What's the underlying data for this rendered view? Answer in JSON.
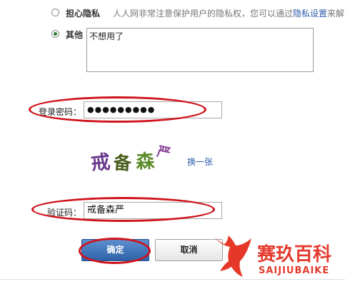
{
  "reasons": {
    "privacy": {
      "label": "担心隐私",
      "desc_prefix": "人人网非常注意保护用户的隐私权，您可以通过",
      "link": "隐私设置",
      "desc_suffix": "来解"
    },
    "other": {
      "label": "其他",
      "text": "不想用了"
    }
  },
  "password": {
    "label": "登录密码：",
    "value": "●●●●●●●●●"
  },
  "captcha": {
    "chars": [
      "戒",
      "备",
      "森",
      "严"
    ],
    "refresh_link": "换一张"
  },
  "verify": {
    "label": "验证码：",
    "value": "戒备森严"
  },
  "buttons": {
    "confirm": "确定",
    "cancel": "取消"
  },
  "watermark": {
    "title": "赛玖百科",
    "subtitle": "SAIJIUBAIKE"
  },
  "colors": {
    "highlight_oval": "#d0131b",
    "primary_button": "#2f63a8",
    "link": "#2a5caa",
    "watermark": "#e43b2e"
  }
}
